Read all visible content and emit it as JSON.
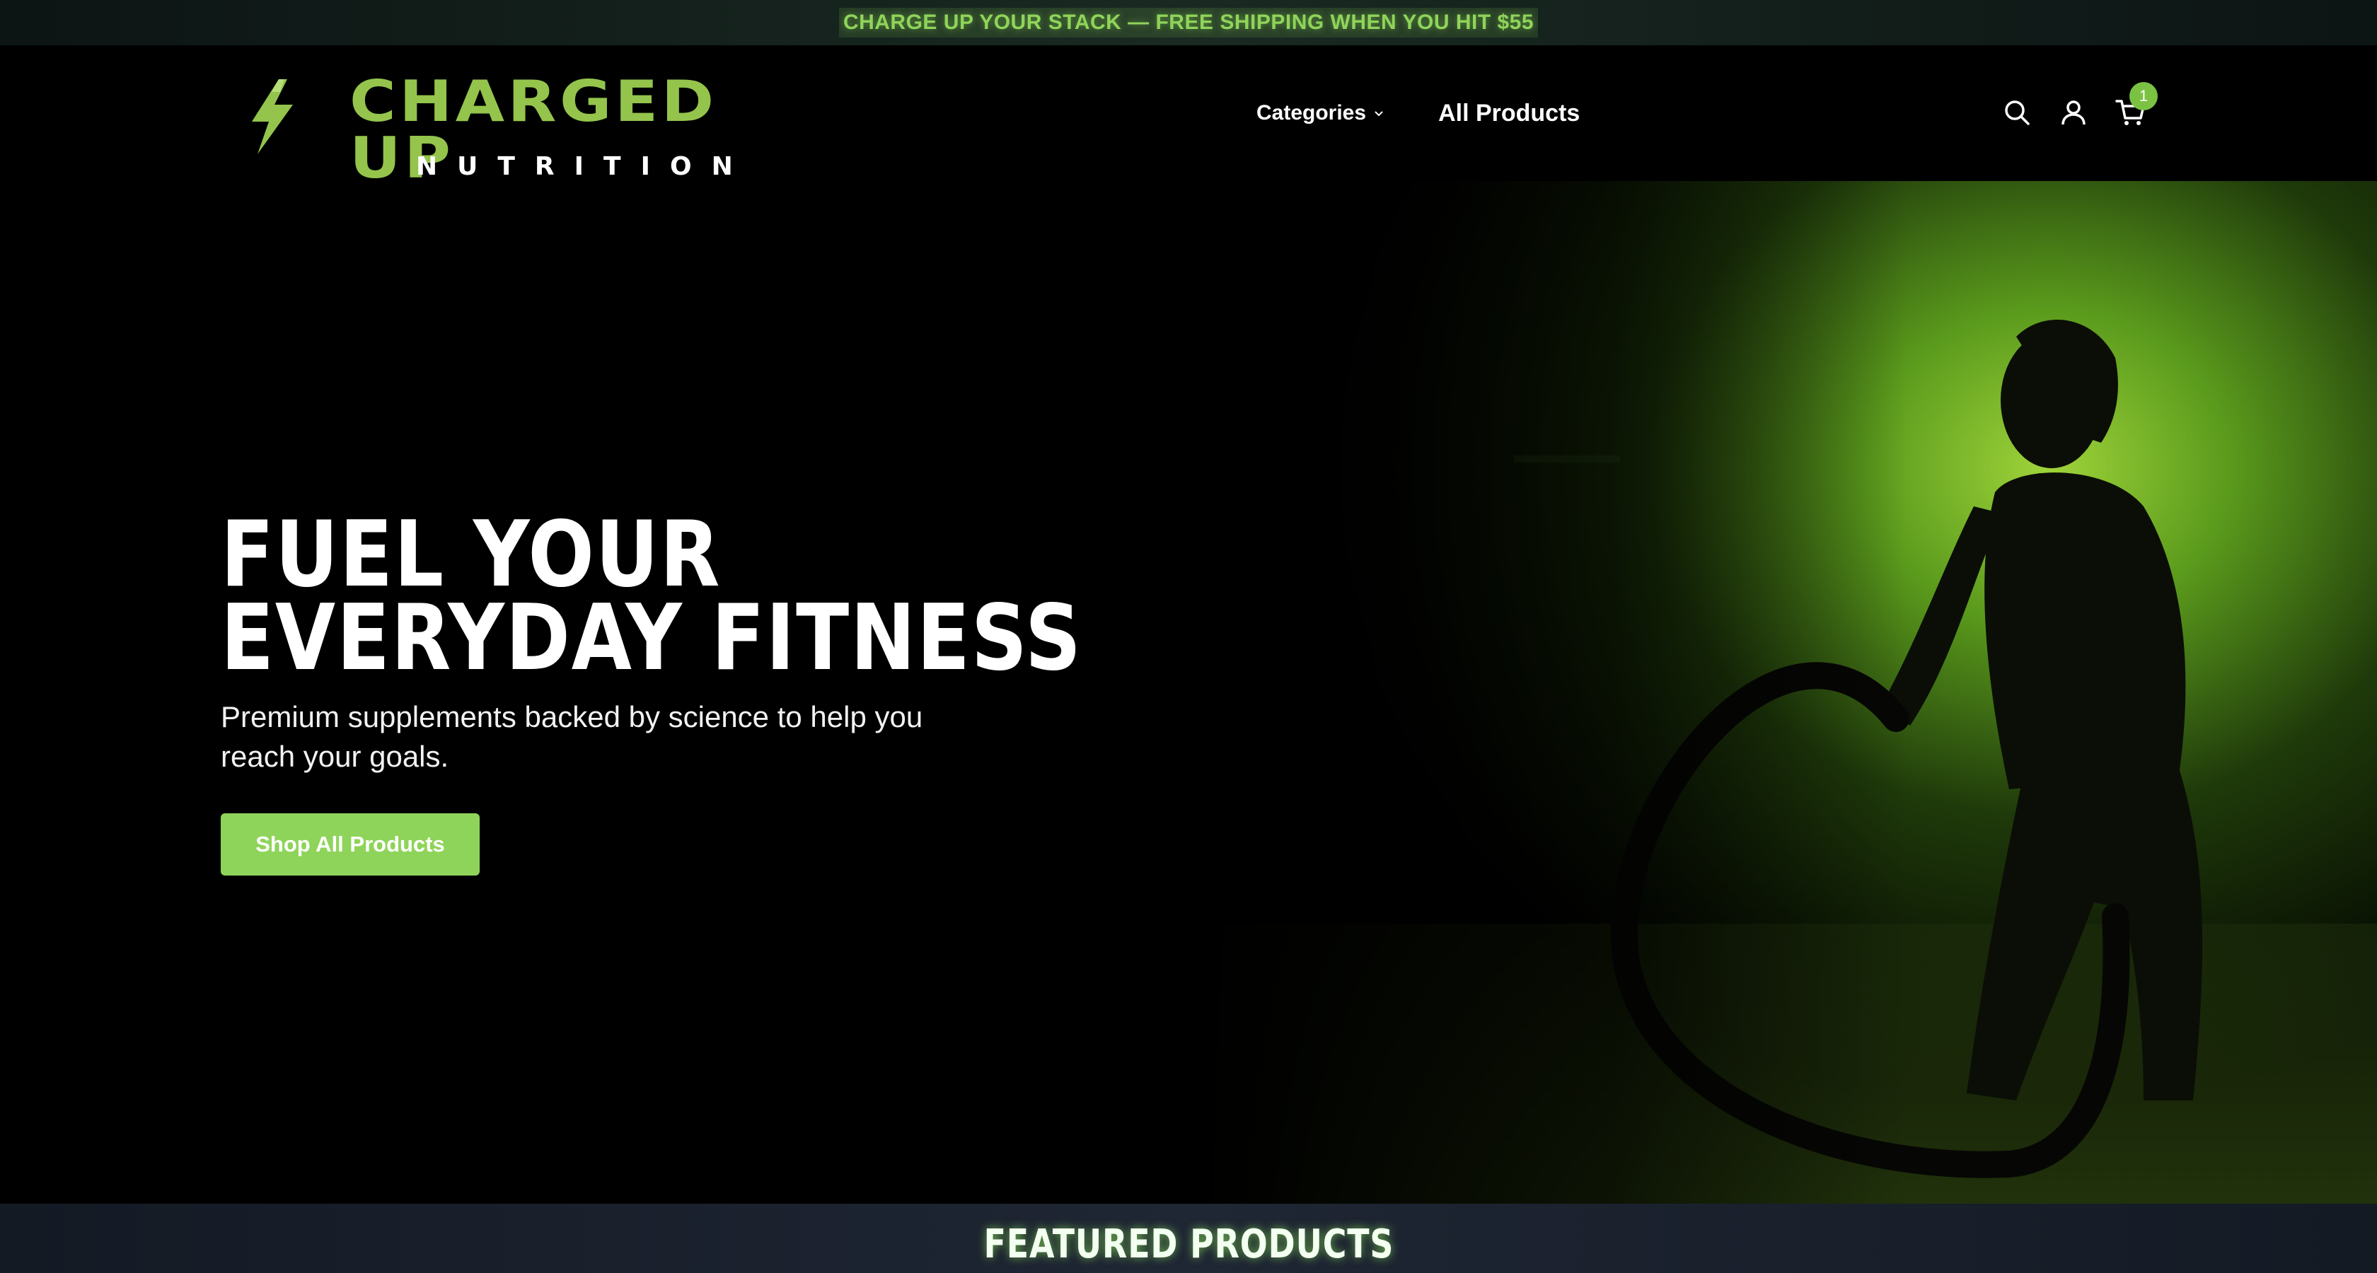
{
  "announcement": {
    "text": "CHARGE UP YOUR STACK — FREE SHIPPING WHEN YOU HIT $55"
  },
  "header": {
    "logo": {
      "main": "CHARGED UP",
      "sub": "NUTRITION"
    },
    "nav": {
      "categories_label": "Categories",
      "all_products_label": "All Products"
    },
    "icons": [
      "search-icon",
      "account-icon",
      "cart-icon"
    ],
    "cart_count": "1"
  },
  "hero": {
    "title_line1": "FUEL YOUR",
    "title_line2": "EVERYDAY FITNESS",
    "subtitle": "Premium supplements backed by science to help you reach your goals.",
    "cta_label": "Shop All Products"
  },
  "featured": {
    "title": "FEATURED PRODUCTS"
  },
  "colors": {
    "accent": "#8fd45a",
    "logo_green": "#94c44c",
    "background": "#000000"
  }
}
